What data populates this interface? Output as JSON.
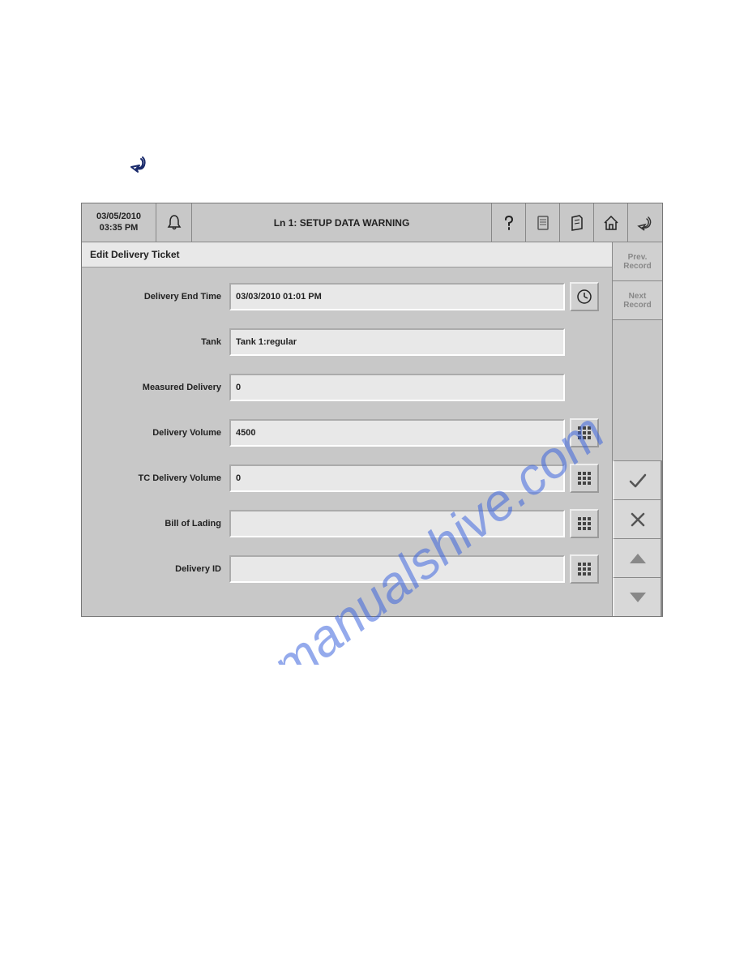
{
  "header": {
    "date": "03/05/2010",
    "time": "03:35 PM",
    "title": "Ln 1: SETUP DATA WARNING"
  },
  "section_title": "Edit Delivery Ticket",
  "fields": {
    "delivery_end_time": {
      "label": "Delivery End Time",
      "value": "03/03/2010 01:01 PM"
    },
    "tank": {
      "label": "Tank",
      "value": "Tank 1:regular"
    },
    "measured_delivery": {
      "label": "Measured Delivery",
      "value": "0"
    },
    "delivery_volume": {
      "label": "Delivery Volume",
      "value": "4500"
    },
    "tc_delivery_volume": {
      "label": "TC Delivery Volume",
      "value": "0"
    },
    "bill_of_lading": {
      "label": "Bill of Lading",
      "value": ""
    },
    "delivery_id": {
      "label": "Delivery ID",
      "value": ""
    }
  },
  "sidebar": {
    "prev_line1": "Prev.",
    "prev_line2": "Record",
    "next_line1": "Next",
    "next_line2": "Record"
  },
  "watermark": "manualshive.com"
}
